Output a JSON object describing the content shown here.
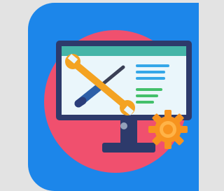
{
  "app_icon": {
    "icon": "maintenance-monitor-icon",
    "depicts": [
      "monitor-icon",
      "wrench-icon",
      "screwdriver-icon",
      "gear-icon"
    ]
  },
  "colors": {
    "page_background": "#e3e3e3",
    "tile_blue": "#1c86ea",
    "backdrop_pink": "#f0506e",
    "monitor_frame": "#2d3a6b",
    "monitor_top_bar": "#45b5a8",
    "screen": "#eaf6fb",
    "wrench": "#f4a322",
    "screwdriver_handle": "#2d5fa8",
    "screwdriver_shaft": "#3a3f55",
    "text_lines_blue": "#35a7e8",
    "text_lines_green": "#43c06b",
    "gear": "#f7931e"
  }
}
